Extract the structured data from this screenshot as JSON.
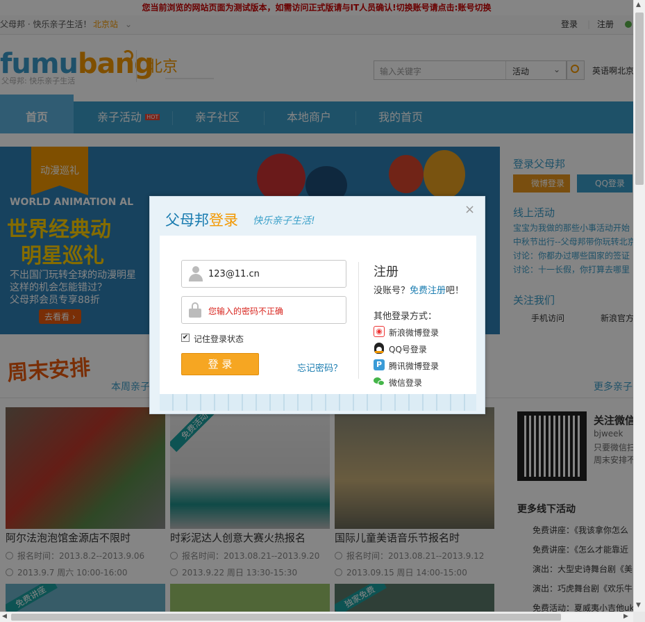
{
  "notice": "您当前浏览的网站页面为测试版本，如需访问正式版请与IT人员确认!切换账号请点击:账号切换",
  "topbar": {
    "slogan": "父母邦 · 快乐亲子生活！",
    "city": "北京站",
    "login": "登录",
    "register": "注册"
  },
  "header": {
    "logo_a": "fumu",
    "logo_b": "bang",
    "logo_sub": "父母邦: 快乐亲子生活",
    "city": "北京",
    "search_placeholder": "输入关键字",
    "search_type": "活动",
    "hot_kw": "英语啊北京"
  },
  "nav": {
    "items": [
      "首页",
      "亲子活动",
      "亲子社区",
      "本地商户",
      "我的首页"
    ],
    "hot": "HOT"
  },
  "banner": {
    "tag": "动漫巡礼",
    "en": "WORLD ANIMATION AL",
    "title1": "世界经典动",
    "title2": "明星巡礼",
    "desc1": "不出国门玩转全球的动漫明星",
    "desc2": "这样的机会怎能错过？",
    "desc3": "父母邦会员专享88折",
    "btn": "去看看 ›"
  },
  "sidebar": {
    "login_title": "登录父母邦",
    "weibo_btn": "微博登录",
    "qq_btn": "QQ登录",
    "online_title": "线上活动",
    "online_items": [
      "宝宝为我做的那些小事活动开始",
      "中秋节出行--父母邦带你玩转北京",
      "讨论：你都办过哪些国家的签证",
      "讨论：十一长假，你打算去哪里"
    ],
    "follow_title": "关注我们",
    "mobile": "手机访问",
    "weibo": "新浪官方"
  },
  "weekend": {
    "logo": "周末安排",
    "sub": "本周亲子",
    "more": "更多亲子"
  },
  "cards": [
    {
      "title": "阿尔法泡泡馆金源店不限时",
      "signup": "报名时间：2013.8.2--2013.9.06",
      "time": "2013.9.7 周六 10:00-16:00"
    },
    {
      "title": "时彩泥达人创意大赛火热报名",
      "signup": "报名时间：2013.08.21--2013.9.20",
      "time": "2013.9.22 周日 13:30-15:30",
      "ribbon": "免费活动"
    },
    {
      "title": "国际儿童美语音乐节报名时",
      "signup": "报名时间：2013.08.21--2013.9.12",
      "time": "2013.09.15 周日 14:00-15:00"
    }
  ],
  "ribbons2": [
    "免费讲座",
    "独家免费"
  ],
  "wechat": {
    "title": "关注微信",
    "id": "bjweek",
    "line1": "只要微信扫",
    "line2": "周末安排不"
  },
  "offline": {
    "title": "更多线下活动",
    "items": [
      "免费讲座：《我该拿你怎么",
      "免费讲座：《怎么才能靠近",
      "演出：大型史诗舞台剧《美",
      "演出：巧虎舞台剧《欢乐牛",
      "免费活动：夏威夷小吉他uk"
    ]
  },
  "modal": {
    "title": "父母邦",
    "title_b": "登录",
    "slogan": "快乐亲子生活!",
    "username": "123@11.cn",
    "password_error": "您输入的密码不正确",
    "remember": "记住登录状态",
    "login_btn": "登 录",
    "forgot": "忘记密码？",
    "reg_title": "注册",
    "no_account": "没账号？",
    "free_reg": "免费注册",
    "ba": "吧！",
    "other": "其他登录方式：",
    "providers": [
      "新浪微博登录",
      "QQ号登录",
      "腾讯微博登录",
      "微信登录"
    ]
  }
}
